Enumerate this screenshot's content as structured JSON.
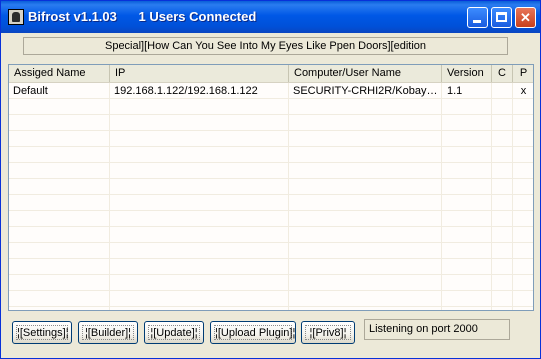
{
  "window": {
    "title": "Bifrost v1.1.03      1 Users Connected",
    "controls": {
      "minimize": "minimize",
      "maximize": "maximize",
      "close": "✕"
    }
  },
  "banner": {
    "text": "Special][How Can You See Into My Eyes Like Ppen Doors][edition"
  },
  "table": {
    "headers": [
      "Assiged Name",
      "IP",
      "Computer/User Name",
      "Version",
      "C",
      "P"
    ],
    "rows": [
      {
        "assigned_name": "Default",
        "ip": "192.168.1.122/192.168.1.122",
        "computer_user": "SECURITY-CRHI2R/Kobaya...",
        "version": "1.1",
        "c": "",
        "p": "x"
      }
    ]
  },
  "buttons": {
    "settings": "¦[Settings]¦",
    "builder": "¦[Builder]¦",
    "update": "¦[Update]¦",
    "upload_plugin": "¦[Upload Plugin]¦",
    "priv8": "¦[Priv8]¦"
  },
  "status": {
    "text": "Listening on port 2000"
  }
}
